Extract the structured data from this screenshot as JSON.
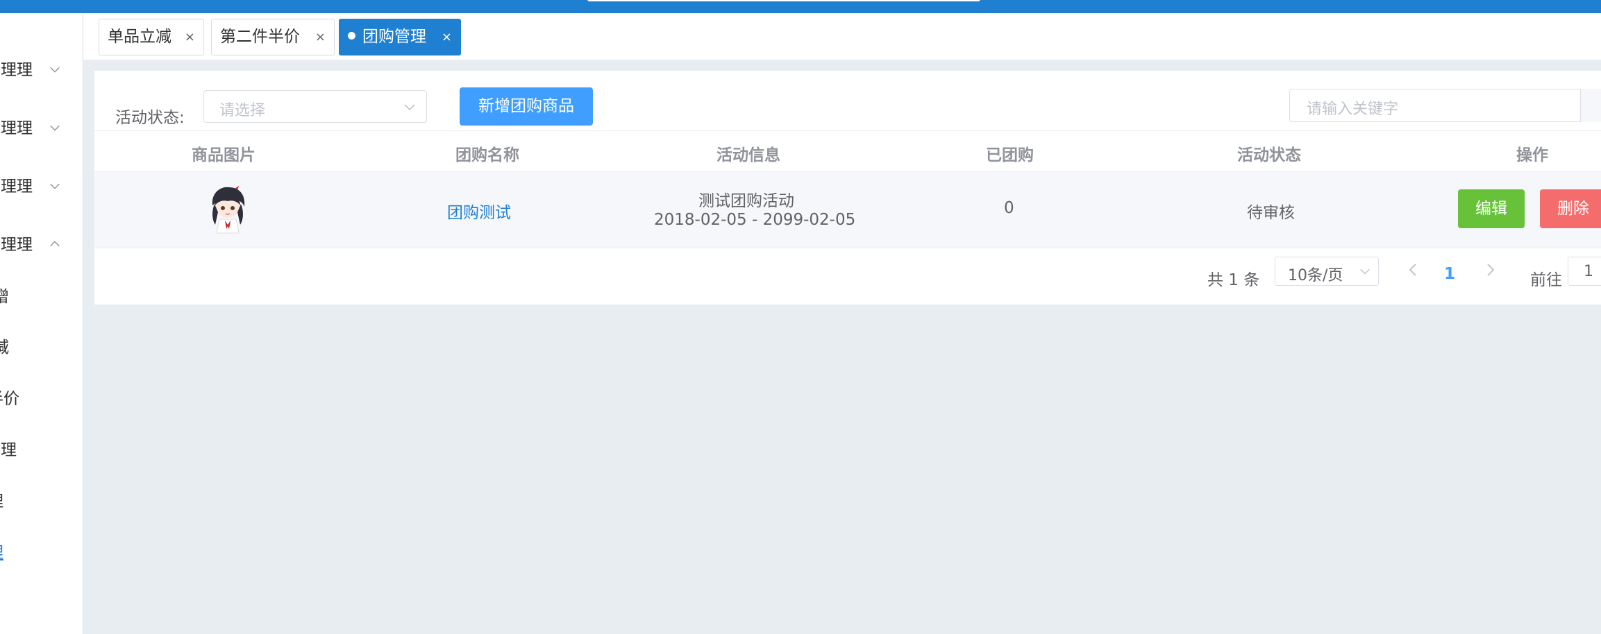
{
  "sidebar": {
    "items": [
      {
        "label": "管理理"
      },
      {
        "label": "管理理"
      },
      {
        "label": "管理理"
      },
      {
        "label": "管理理"
      },
      {
        "label": "增"
      },
      {
        "label": "减"
      },
      {
        "label": "半价"
      },
      {
        "label": "管理"
      },
      {
        "label": "理"
      },
      {
        "label": "理"
      }
    ]
  },
  "tabs": [
    {
      "label": "单品立减",
      "close": "×"
    },
    {
      "label": "第二件半价",
      "close": "×"
    },
    {
      "label": "团购管理",
      "close": "×"
    }
  ],
  "filter": {
    "label": "活动状态:",
    "select_placeholder": "请选择",
    "add_button": "新增团购商品",
    "search_placeholder": "请输入关键字"
  },
  "table": {
    "headers": [
      "商品图片",
      "团购名称",
      "活动信息",
      "已团购",
      "活动状态",
      "操作"
    ],
    "rows": [
      {
        "name": "团购测试",
        "activity_title": "测试团购活动",
        "activity_dates": "2018-02-05 - 2099-02-05",
        "purchased": "0",
        "status": "待审核",
        "edit": "编辑",
        "delete": "删除"
      }
    ]
  },
  "pagination": {
    "total": "共 1 条",
    "page_size": "10条/页",
    "current_page": "1",
    "goto_label": "前往",
    "goto_value": "1"
  },
  "colors": {
    "primary": "#1f7fd1",
    "accent": "#409eff",
    "success": "#67c23a",
    "danger": "#f56c6c"
  }
}
